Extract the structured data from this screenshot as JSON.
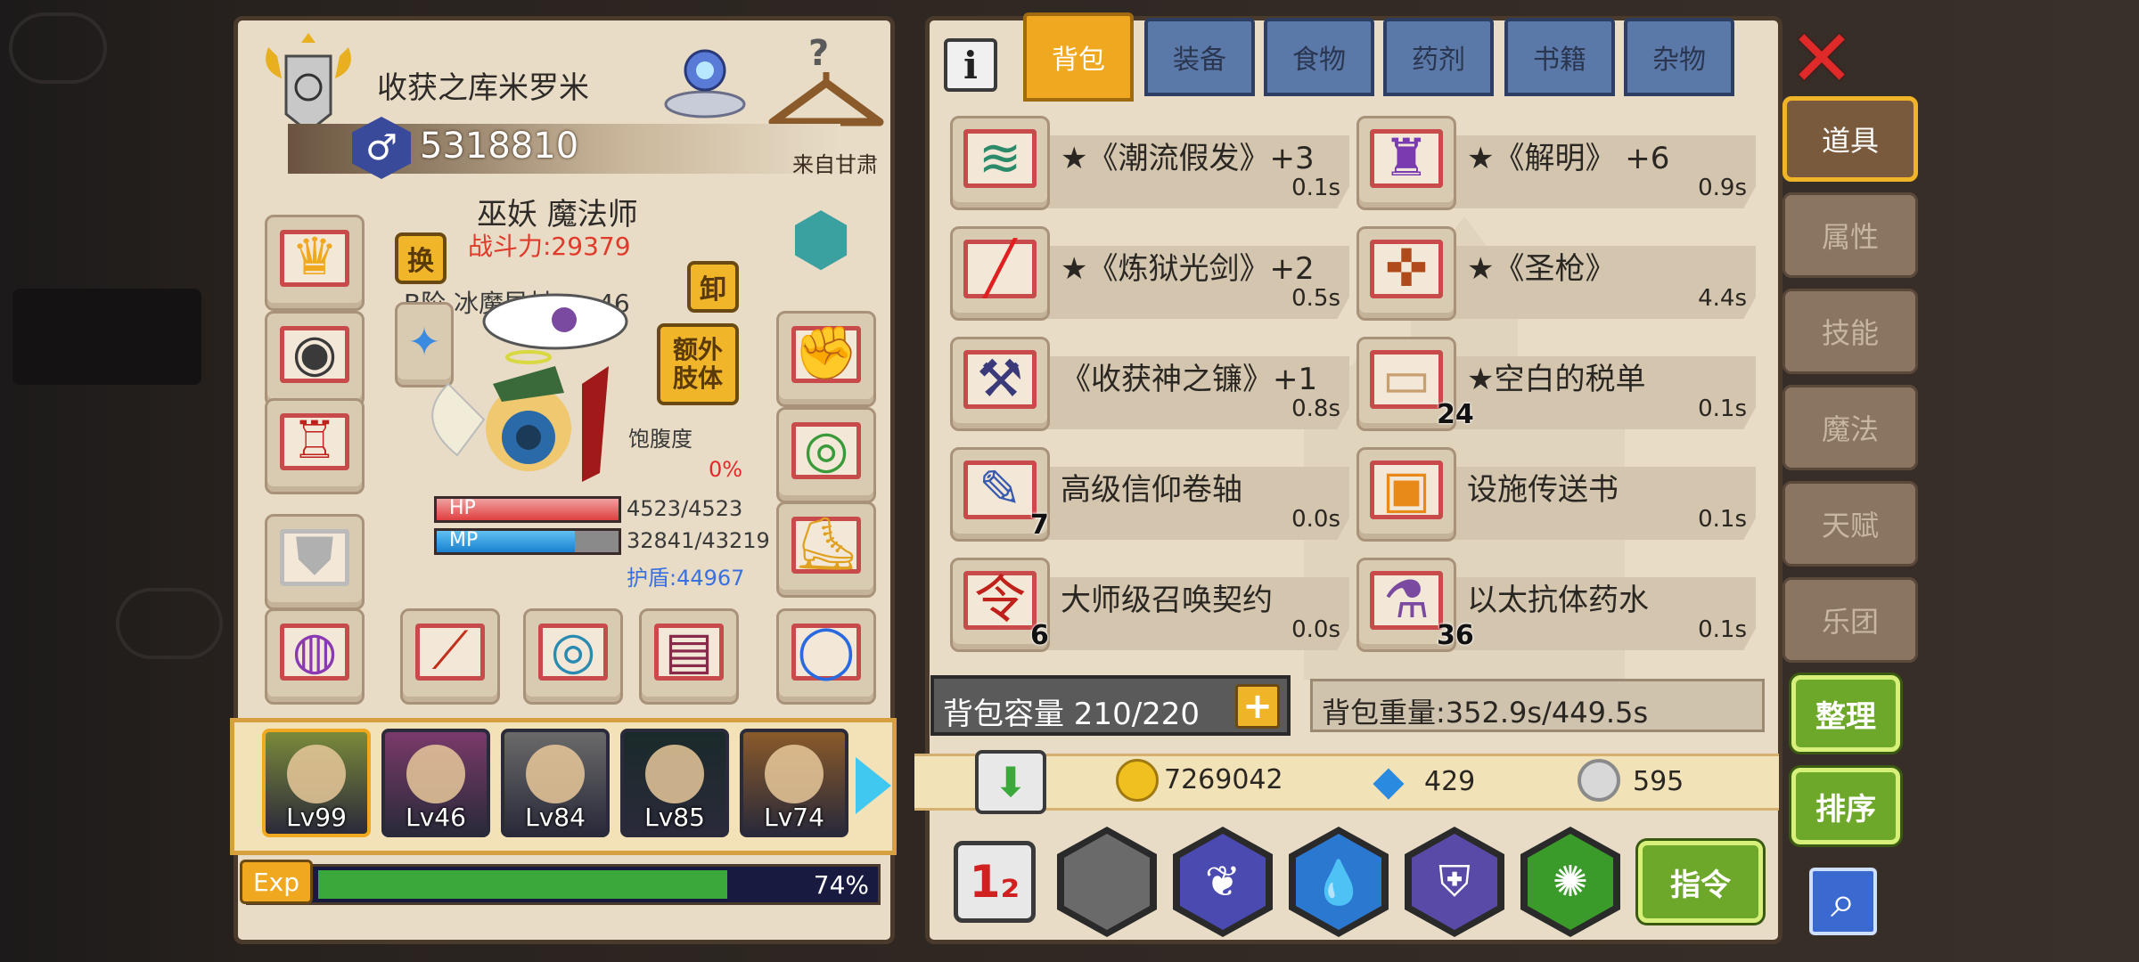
{
  "character": {
    "player_name": "收获之库米罗米",
    "player_id": "5318810",
    "origin": "来自甘肃",
    "class_name": "巫妖 魔法师",
    "combat_power": "战斗力:29379",
    "weapon_info": "B阶 冰魔导杖 Lv 46",
    "swap_label": "换",
    "unequip_label": "卸",
    "extra_limb_label": "额外\n肢体",
    "satiety_label": "饱腹度",
    "satiety_value": "0%",
    "hp_label": "HP",
    "hp_value": "4523/4523",
    "hp_fraction": 1.0,
    "mp_label": "MP",
    "mp_value": "32841/43219",
    "mp_fraction": 0.76,
    "shield": "护盾:44967",
    "help_icon": "?"
  },
  "roster": [
    {
      "level": "Lv99",
      "color": "#7a8a3a"
    },
    {
      "level": "Lv46",
      "color": "#7a3a6a"
    },
    {
      "level": "Lv84",
      "color": "#6a6a6a"
    },
    {
      "level": "Lv85",
      "color": "#1a2a2a"
    },
    {
      "level": "Lv74",
      "color": "#8a5a2a"
    }
  ],
  "exp": {
    "label": "Exp",
    "percent": "74%",
    "fraction": 0.74
  },
  "tabs": {
    "info_icon": "i",
    "items": [
      "背包",
      "装备",
      "食物",
      "药剂",
      "书籍",
      "杂物"
    ],
    "active": 0
  },
  "bag_items": [
    {
      "name": "★《潮流假发》+3",
      "weight": "0.1s",
      "icon": "wig-icon",
      "glyph": "≋",
      "color": "#2a8a6a",
      "qty": ""
    },
    {
      "name": "★《解明》 +6",
      "weight": "0.9s",
      "icon": "cape-icon",
      "glyph": "♜",
      "color": "#7a3ab0",
      "qty": ""
    },
    {
      "name": "★《炼狱光剑》+2",
      "weight": "0.5s",
      "icon": "lightsaber-icon",
      "glyph": "╱",
      "color": "#e02020",
      "qty": ""
    },
    {
      "name": "★《圣枪》",
      "weight": "4.4s",
      "icon": "holy-spear-icon",
      "glyph": "✜",
      "color": "#b04a1a",
      "qty": ""
    },
    {
      "name": "《收获神之镰》+1",
      "weight": "0.8s",
      "icon": "scythe-icon",
      "glyph": "⚒",
      "color": "#3a3a7a",
      "qty": ""
    },
    {
      "name": "★空白的税单",
      "weight": "0.1s",
      "icon": "tax-form-icon",
      "glyph": "▭",
      "color": "#c8a070",
      "qty": "24"
    },
    {
      "name": "高级信仰卷轴",
      "weight": "0.0s",
      "icon": "scroll-icon",
      "glyph": "✎",
      "color": "#3a5ab0",
      "qty": "7"
    },
    {
      "name": "设施传送书",
      "weight": "0.1s",
      "icon": "teleport-book-icon",
      "glyph": "▣",
      "color": "#e88a1a",
      "qty": ""
    },
    {
      "name": "大师级召唤契约",
      "weight": "0.0s",
      "icon": "summon-contract-icon",
      "glyph": "令",
      "color": "#c0201a",
      "qty": "6"
    },
    {
      "name": "以太抗体药水",
      "weight": "0.1s",
      "icon": "potion-icon",
      "glyph": "⚗",
      "color": "#7a4aa0",
      "qty": "36"
    }
  ],
  "capacity": {
    "label": "背包容量 210/220",
    "weight_label": "背包重量:352.9s/449.5s"
  },
  "currency": {
    "gold": "7269042",
    "diamond": "429",
    "silver": "595"
  },
  "side_tabs": {
    "items": [
      "道具",
      "属性",
      "技能",
      "魔法",
      "天赋",
      "乐团"
    ],
    "active": 0
  },
  "buttons": {
    "sort_label": "整理",
    "order_label": "排序",
    "command_label": "指令",
    "close_icon": "✕"
  },
  "skills": {
    "swap_12": "1₂",
    "slots": [
      {
        "icon": "empty-slot-icon",
        "glyph": "",
        "color": "#6a6a6a"
      },
      {
        "icon": "feather-skill-icon",
        "glyph": "❦",
        "color": "#4a4ab0"
      },
      {
        "icon": "water-drop-skill-icon",
        "glyph": "💧",
        "color": "#2a78d0"
      },
      {
        "icon": "shield-skill-icon",
        "glyph": "⛨",
        "color": "#5a4aa8"
      },
      {
        "icon": "nature-burst-skill-icon",
        "glyph": "✺",
        "color": "#3a9a2a"
      }
    ]
  }
}
